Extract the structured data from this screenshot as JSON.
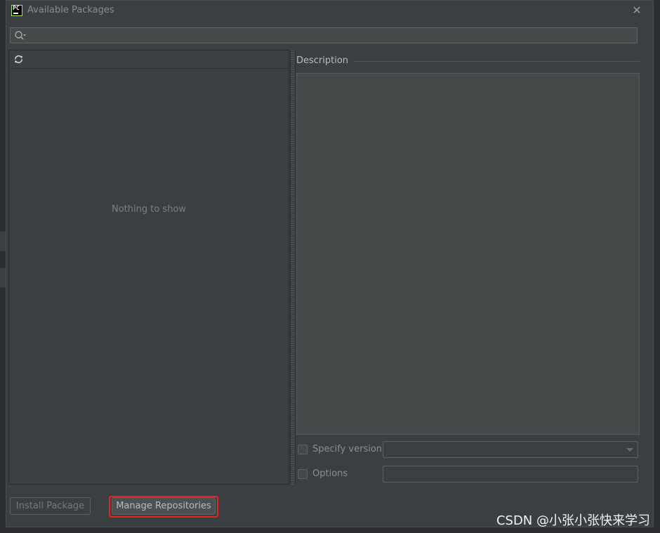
{
  "window": {
    "app_logo_text": "PC",
    "title": "Available Packages",
    "close_symbol": "✕"
  },
  "search": {
    "value": "",
    "placeholder": ""
  },
  "package_list": {
    "empty_text": "Nothing to show"
  },
  "description": {
    "label": "Description",
    "text": ""
  },
  "options": {
    "specify_version_label": "Specify version",
    "specify_version_checked": false,
    "version_value": "",
    "options_label": "Options",
    "options_checked": false,
    "options_value": ""
  },
  "buttons": {
    "install_label": "Install Package",
    "manage_label": "Manage Repositories"
  },
  "watermark": {
    "text": "CSDN @小张小张快来学习"
  },
  "colors": {
    "dialog_bg": "#3c3f41",
    "field_bg": "#45494a",
    "highlight": "#e3261f"
  },
  "icons": {
    "search": "search-icon",
    "refresh": "refresh-icon",
    "close": "close-icon",
    "dropdown": "chevron-down-icon"
  }
}
